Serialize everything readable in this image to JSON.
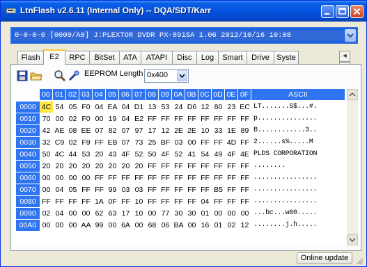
{
  "window": {
    "title": "LtnFlash v2.6.11 (Internal Only) -- DQA/SDT/Karr"
  },
  "device_selector": {
    "value": "0-0-0-0 [0000/A0] J:PLEXTOR DVDR    PX-891SA  1.06 2012/10/16 10:08"
  },
  "tabs": [
    {
      "label": "Flash"
    },
    {
      "label": "E2",
      "active": true
    },
    {
      "label": "RPC"
    },
    {
      "label": "BitSet"
    },
    {
      "label": "ATA"
    },
    {
      "label": "ATAPI"
    },
    {
      "label": "Disc"
    },
    {
      "label": "Log"
    },
    {
      "label": "Smart"
    },
    {
      "label": "Drive"
    },
    {
      "label": "Syste"
    }
  ],
  "toolbar": {
    "icons": [
      "save-icon",
      "open-folder-icon",
      "find-icon",
      "wand-icon"
    ],
    "eeprom_length_label": "EEPROM Length",
    "eeprom_length_value": "0x400"
  },
  "hex_view": {
    "columns": [
      "00",
      "01",
      "02",
      "03",
      "04",
      "05",
      "06",
      "07",
      "08",
      "09",
      "0A",
      "0B",
      "0C",
      "0D",
      "0E",
      "0F"
    ],
    "ascii_header": "ASCII",
    "selected_cell": {
      "row": 0,
      "col": 0
    },
    "rows": [
      {
        "addr": "0000",
        "bytes": [
          "4C",
          "54",
          "05",
          "F0",
          "04",
          "EA",
          "04",
          "D1",
          "13",
          "53",
          "24",
          "D6",
          "12",
          "80",
          "23",
          "EC"
        ],
        "ascii": "LT.......S$...#."
      },
      {
        "addr": "0010",
        "bytes": [
          "70",
          "00",
          "02",
          "F0",
          "00",
          "19",
          "04",
          "E2",
          "FF",
          "FF",
          "FF",
          "FF",
          "FF",
          "FF",
          "FF",
          "FF"
        ],
        "ascii": "p..............."
      },
      {
        "addr": "0020",
        "bytes": [
          "42",
          "AE",
          "08",
          "EE",
          "07",
          "82",
          "07",
          "97",
          "17",
          "12",
          "2E",
          "2E",
          "10",
          "33",
          "1E",
          "89"
        ],
        "ascii": "B............3.."
      },
      {
        "addr": "0030",
        "bytes": [
          "32",
          "C9",
          "02",
          "F9",
          "FF",
          "EB",
          "07",
          "73",
          "25",
          "BF",
          "03",
          "00",
          "FF",
          "FF",
          "4D",
          "FF"
        ],
        "ascii": "2......s%.....M"
      },
      {
        "addr": "0040",
        "bytes": [
          "50",
          "4C",
          "44",
          "53",
          "20",
          "43",
          "4F",
          "52",
          "50",
          "4F",
          "52",
          "41",
          "54",
          "49",
          "4F",
          "4E"
        ],
        "ascii": "PLDS CORPORATION"
      },
      {
        "addr": "0050",
        "bytes": [
          "20",
          "20",
          "20",
          "20",
          "20",
          "20",
          "20",
          "20",
          "FF",
          "FF",
          "FF",
          "FF",
          "FF",
          "FF",
          "FF",
          "FF"
        ],
        "ascii": "        ........"
      },
      {
        "addr": "0060",
        "bytes": [
          "00",
          "00",
          "00",
          "00",
          "FF",
          "FF",
          "FF",
          "FF",
          "FF",
          "FF",
          "FF",
          "FF",
          "FF",
          "FF",
          "FF",
          "FF"
        ],
        "ascii": "................"
      },
      {
        "addr": "0070",
        "bytes": [
          "00",
          "04",
          "05",
          "FF",
          "FF",
          "99",
          "03",
          "03",
          "FF",
          "FF",
          "FF",
          "FF",
          "FF",
          "B5",
          "FF",
          "FF"
        ],
        "ascii": "................"
      },
      {
        "addr": "0080",
        "bytes": [
          "FF",
          "FF",
          "FF",
          "FF",
          "1A",
          "0F",
          "FF",
          "10",
          "FF",
          "FF",
          "FF",
          "FF",
          "04",
          "FF",
          "FF",
          "FF"
        ],
        "ascii": "................"
      },
      {
        "addr": "0090",
        "bytes": [
          "02",
          "04",
          "00",
          "00",
          "62",
          "63",
          "17",
          "10",
          "00",
          "77",
          "30",
          "30",
          "01",
          "00",
          "00",
          "00"
        ],
        "ascii": "...bc...w00....."
      },
      {
        "addr": "00A0",
        "bytes": [
          "00",
          "00",
          "00",
          "AA",
          "99",
          "00",
          "6A",
          "00",
          "68",
          "06",
          "BA",
          "00",
          "16",
          "01",
          "02",
          "12"
        ],
        "ascii": "........j.h....."
      }
    ]
  },
  "status": {
    "online_update_label": "Online update"
  },
  "colors": {
    "titlebar": "#0553e0",
    "header_blue": "#2f75f1",
    "selected_cell": "#ffe845",
    "tab_highlight": "#ffc83c"
  }
}
